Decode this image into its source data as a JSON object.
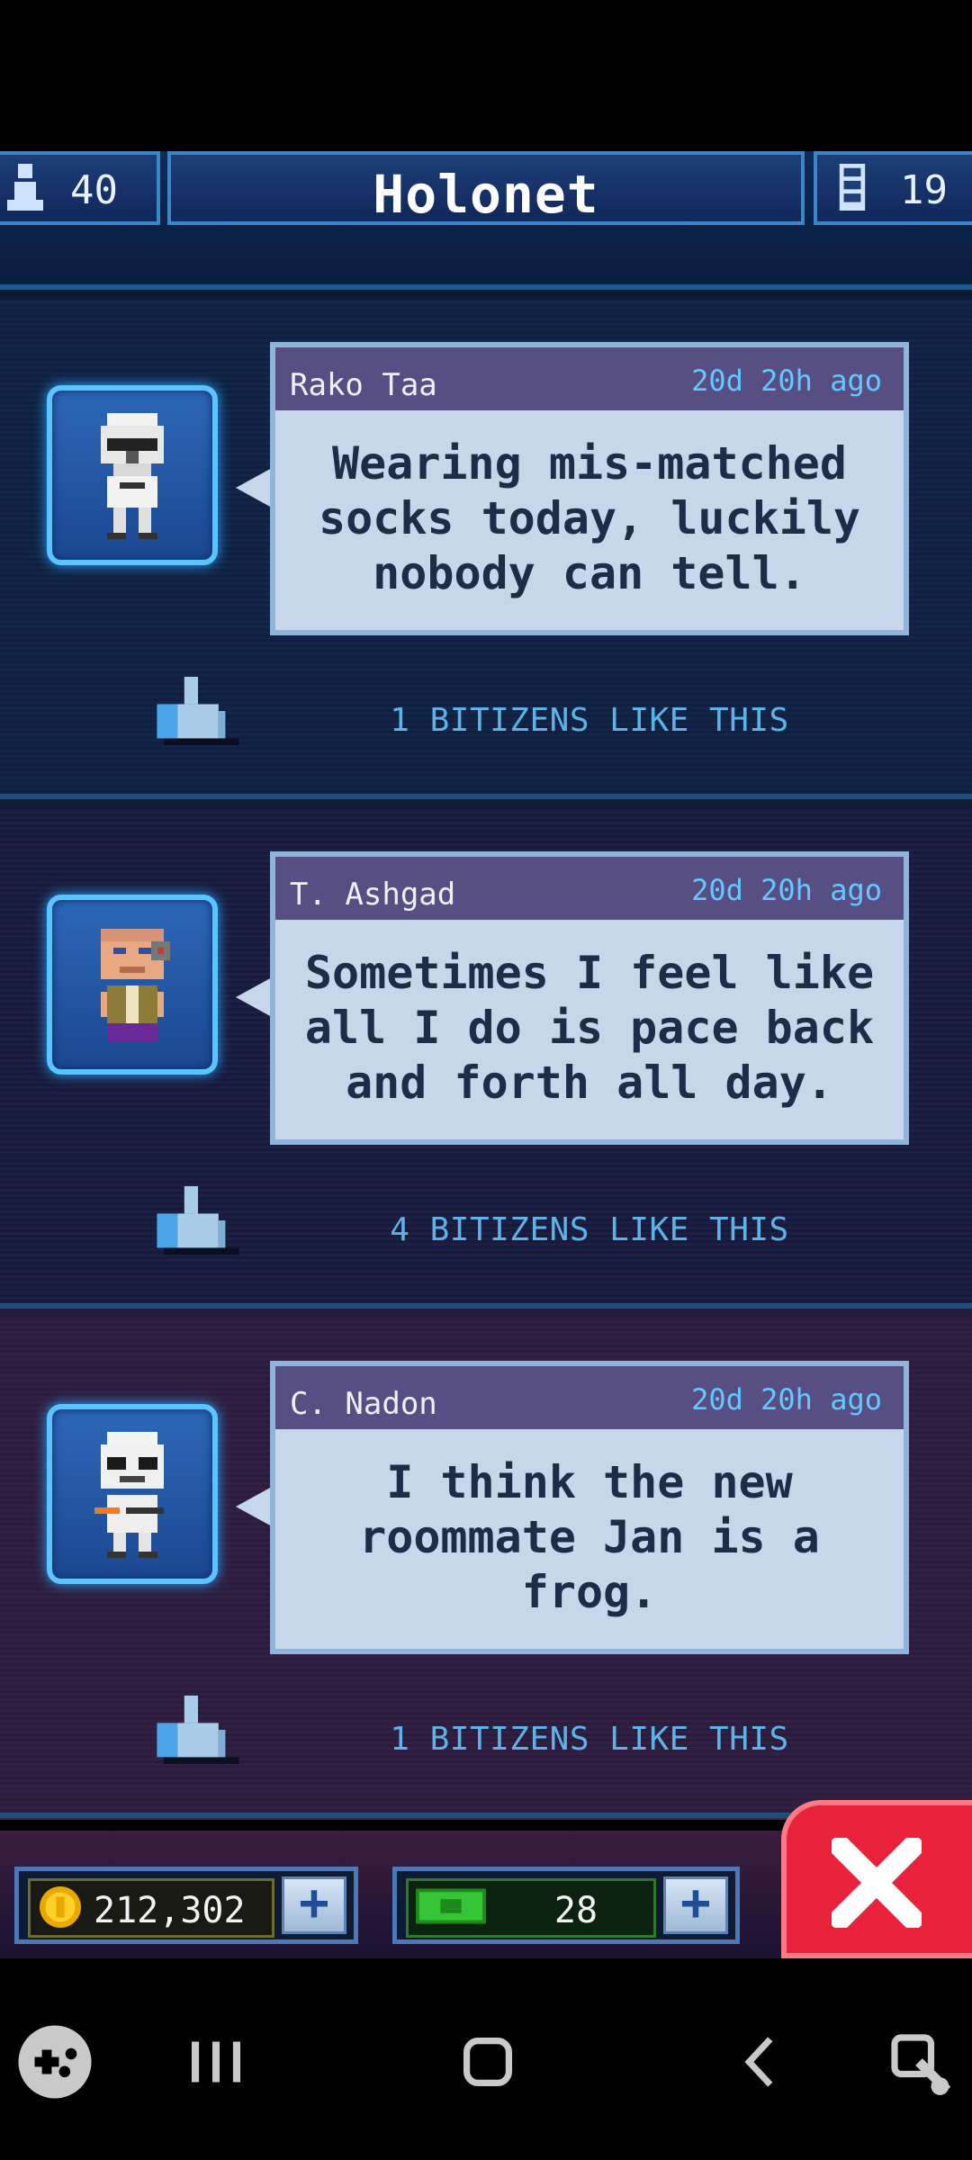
{
  "header": {
    "population": "40",
    "title": "Holonet",
    "floors": "19"
  },
  "posts": [
    {
      "author": "Rako Taa",
      "time": "20d 20h ago",
      "message": "Wearing mis-matched socks today, luckily nobody can tell.",
      "likes_text": "1 BITIZENS LIKE THIS"
    },
    {
      "author": "T. Ashgad",
      "time": "20d 20h ago",
      "message": "Sometimes I feel like all I do is pace back and forth all day.",
      "likes_text": "4 BITIZENS LIKE THIS"
    },
    {
      "author": "C. Nadon",
      "time": "20d 20h ago",
      "message": "I think the new roommate Jan is a frog.",
      "likes_text": "1 BITIZENS LIKE THIS"
    }
  ],
  "footer": {
    "coins": "212,302",
    "bux": "28"
  },
  "icons": {
    "population": "person-icon",
    "floors": "floor-icon",
    "like": "thumbs-up-icon",
    "coin": "coin-icon",
    "bux": "bux-icon",
    "close": "close-icon"
  },
  "colors": {
    "accent": "#59c4ff",
    "likes_text": "#5cb3e8",
    "bubble": "#c7d7ea",
    "bubble_header": "#574f84",
    "close": "#e8223a"
  }
}
